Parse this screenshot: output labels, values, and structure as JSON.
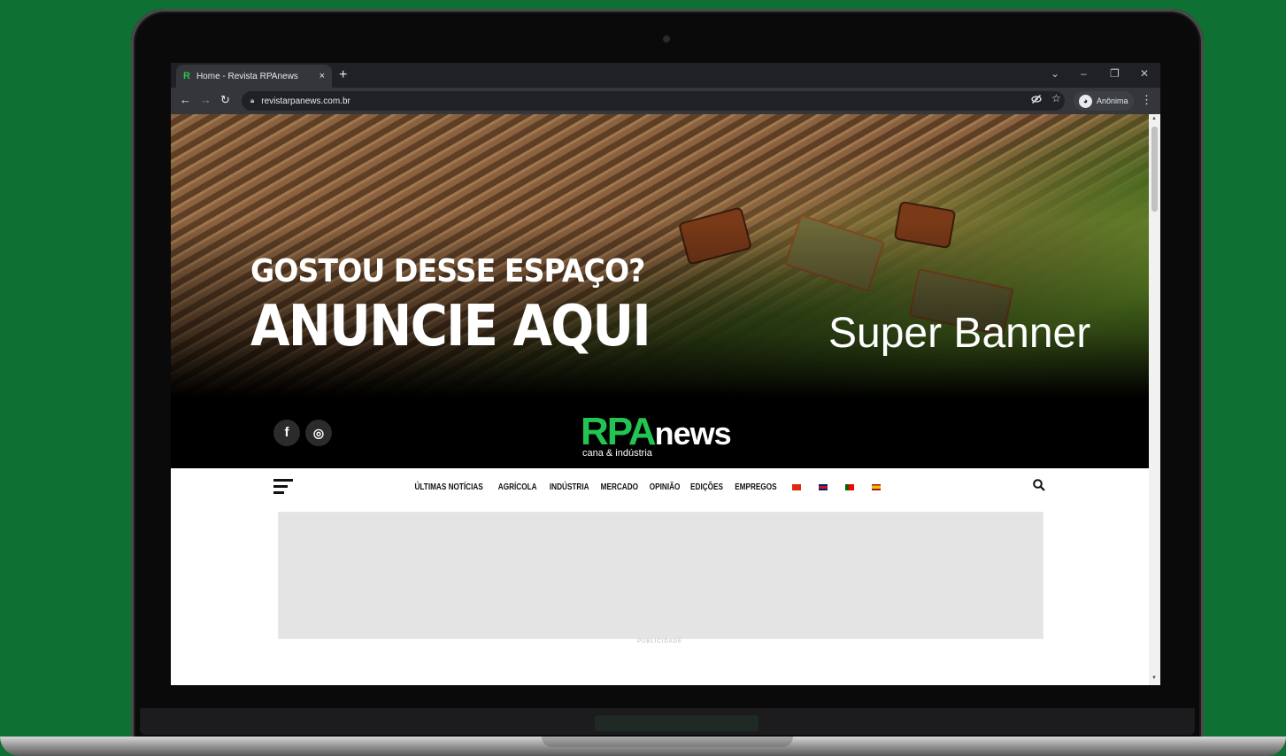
{
  "browser": {
    "tab_title": "Home - Revista RPAnews",
    "favicon": "R",
    "new_tab": "+",
    "tab_close": "×",
    "url": "revistarpanews.com.br",
    "profile_label": "Anônima",
    "window_controls": [
      "⌄",
      "–",
      "❐",
      "✕"
    ],
    "nav_icons": [
      "←",
      "→",
      "↻"
    ],
    "toolbar_icons": [
      "eye-off-icon",
      "star-icon"
    ]
  },
  "banner": {
    "line1": "GOSTOU DESSE ESPAÇO?",
    "line2": "ANUNCIE AQUI",
    "label": "Super Banner"
  },
  "header": {
    "logo_rpa": "RPA",
    "logo_news": "news",
    "logo_sub": "cana & indústria",
    "social": [
      {
        "icon": "facebook-icon",
        "glyph": "f"
      },
      {
        "icon": "instagram-icon",
        "glyph": "◎"
      }
    ]
  },
  "nav": {
    "items": [
      "ÚLTIMAS NOTÍCIAS",
      "AGRÍCOLA",
      "INDÚSTRIA",
      "MERCADO",
      "OPINIÃO",
      "EDIÇÕES",
      "EMPREGOS"
    ],
    "flags": [
      {
        "name": "china-flag",
        "color": "#de2910"
      },
      {
        "name": "uk-flag",
        "color": "#c8102e"
      },
      {
        "name": "portugal-flag",
        "color": "#006600"
      },
      {
        "name": "spain-flag",
        "color": "#f1bf00"
      }
    ]
  },
  "ad": {
    "label": "PUBLICIDADE"
  },
  "colors": {
    "brand_green": "#23c552",
    "background_green": "#0f7034"
  }
}
